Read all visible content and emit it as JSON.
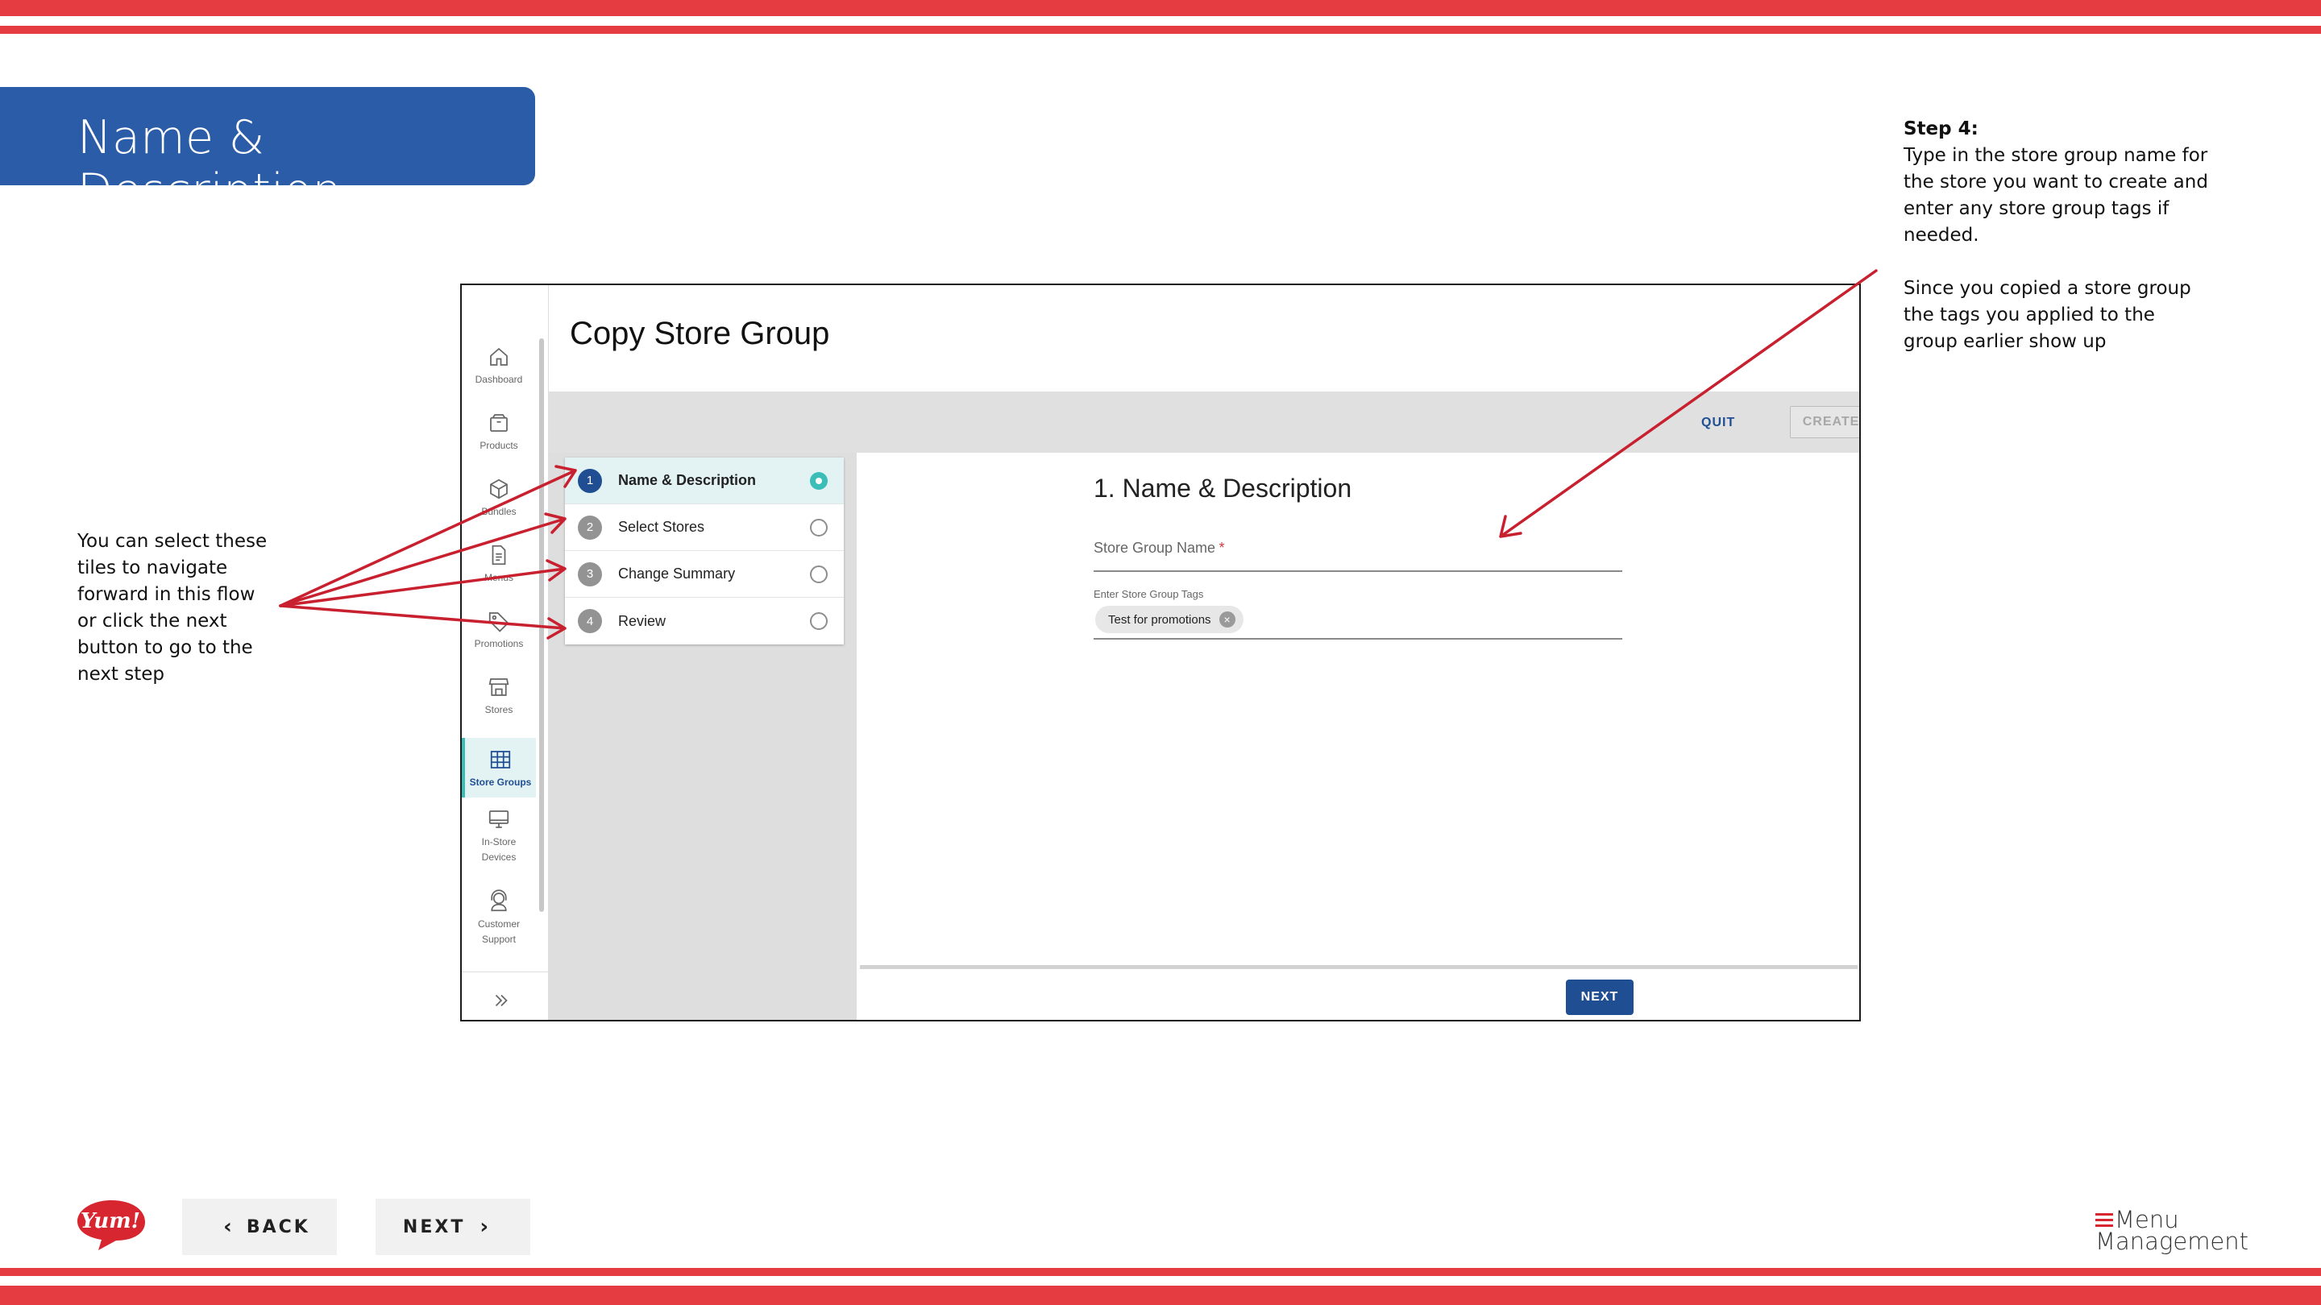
{
  "slide": {
    "title": "Name & Description",
    "left_note": "You can select these tiles to navigate forward in this flow or click the next button to go to the next step",
    "right_note": {
      "step_title": "Step 4:",
      "paragraph1": "Type in the store group name for the store you want to create and enter any store group tags if needed.",
      "paragraph2": "Since you copied a store group the tags you applied to the group earlier show up"
    }
  },
  "sidebar": {
    "items": [
      {
        "label": "Dashboard",
        "icon": "home-icon"
      },
      {
        "label": "Products",
        "icon": "box-icon"
      },
      {
        "label": "Bundles",
        "icon": "cube-icon"
      },
      {
        "label": "Menus",
        "icon": "menu-document-icon"
      },
      {
        "label": "Promotions",
        "icon": "tag-icon"
      },
      {
        "label": "Stores",
        "icon": "storefront-icon"
      },
      {
        "label": "Store Groups",
        "icon": "grid-icon",
        "active": true
      },
      {
        "label": "In-Store Devices",
        "icon": "monitor-icon"
      },
      {
        "label": "Customer Support",
        "icon": "headset-icon"
      }
    ],
    "expand_icon": "double-chevron-right-icon"
  },
  "app": {
    "page_title": "Copy Store Group",
    "toolbar": {
      "quit": "QUIT",
      "create": "CREATE"
    }
  },
  "steps": [
    {
      "number": "1",
      "label": "Name & Description",
      "active": true
    },
    {
      "number": "2",
      "label": "Select Stores"
    },
    {
      "number": "3",
      "label": "Change Summary"
    },
    {
      "number": "4",
      "label": "Review"
    }
  ],
  "form": {
    "heading": "1. Name & Description",
    "name_label": "Store Group Name",
    "name_required_mark": "*",
    "tags_label": "Enter Store Group Tags",
    "tag_chip": "Test for promotions",
    "next_button": "NEXT"
  },
  "bottom_nav": {
    "back": "BACK",
    "next": "NEXT",
    "logo_text": "Yum!",
    "brand_line1": "Menu",
    "brand_line2": "Management"
  },
  "colors": {
    "stripe_red": "#e43c41",
    "banner_blue": "#2a5ca8",
    "primary_blue": "#1f4e93",
    "teal": "#3bbdb8",
    "annotation_red": "#c8202f"
  }
}
